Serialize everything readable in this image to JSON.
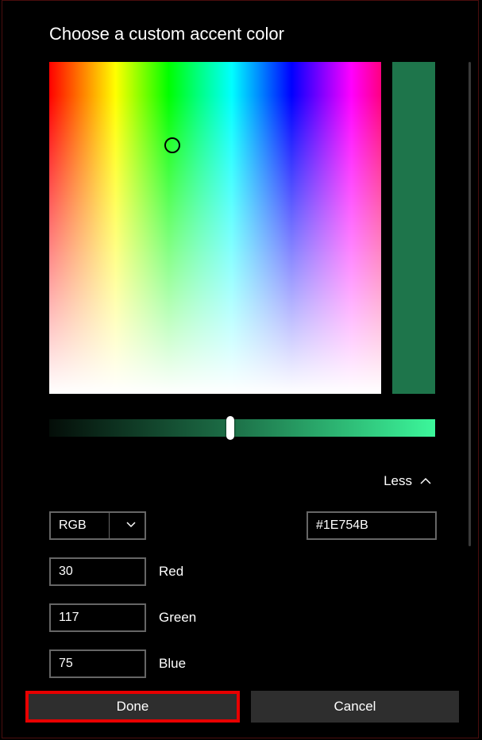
{
  "dialog": {
    "title": "Choose a custom accent color"
  },
  "color": {
    "preview_hex": "#1E754B",
    "hex_value": "#1E754B",
    "luminance_gradient_start": "#040d08",
    "luminance_gradient_mid": "#1E754B",
    "luminance_gradient_end": "#3cf79b"
  },
  "toggle": {
    "less_label": "Less"
  },
  "mode": {
    "selected": "RGB"
  },
  "channels": {
    "red": {
      "value": "30",
      "label": "Red"
    },
    "green": {
      "value": "117",
      "label": "Green"
    },
    "blue": {
      "value": "75",
      "label": "Blue"
    }
  },
  "buttons": {
    "done": "Done",
    "cancel": "Cancel"
  }
}
